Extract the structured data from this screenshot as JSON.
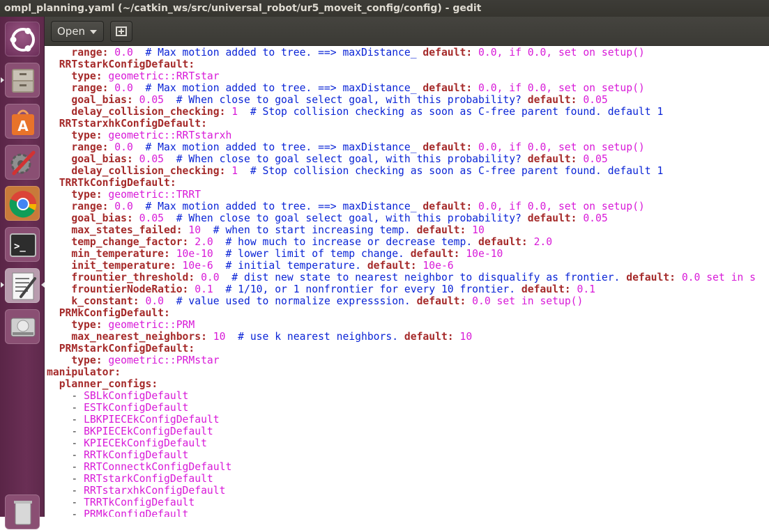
{
  "window": {
    "title": "ompl_planning.yaml (~/catkin_ws/src/universal_robot/ur5_moveit_config/config) - gedit"
  },
  "launcher": {
    "items": [
      {
        "name": "ubuntu-dash-icon"
      },
      {
        "name": "files-icon"
      },
      {
        "name": "software-center-icon"
      },
      {
        "name": "system-settings-icon"
      },
      {
        "name": "chrome-icon"
      },
      {
        "name": "terminal-icon"
      },
      {
        "name": "text-editor-icon"
      },
      {
        "name": "drive-icon"
      },
      {
        "name": "trash-icon"
      }
    ]
  },
  "toolbar": {
    "open_label": "Open",
    "new_tab_icon": "new-tab-icon"
  },
  "colors": {
    "key": "#a52a2a",
    "string": "#d81ad8",
    "comment": "#0a24d6",
    "launcher": "#6a2f55",
    "titlebar": "#3c3b37"
  },
  "editor": {
    "lines": [
      [
        {
          "t": "p",
          "v": "    "
        },
        {
          "t": "k",
          "v": "range:"
        },
        {
          "t": "s",
          "v": " 0.0"
        },
        {
          "t": "c",
          "v": "  # Max motion added to tree. ==> maxDistance_ "
        },
        {
          "t": "k",
          "v": "default:"
        },
        {
          "t": "s",
          "v": " 0.0, if 0.0, set on setup()"
        }
      ],
      [
        {
          "t": "p",
          "v": "  "
        },
        {
          "t": "k",
          "v": "RRTstarkConfigDefault:"
        }
      ],
      [
        {
          "t": "p",
          "v": "    "
        },
        {
          "t": "k",
          "v": "type:"
        },
        {
          "t": "s",
          "v": " geometric::RRTstar"
        }
      ],
      [
        {
          "t": "p",
          "v": "    "
        },
        {
          "t": "k",
          "v": "range:"
        },
        {
          "t": "s",
          "v": " 0.0"
        },
        {
          "t": "c",
          "v": "  # Max motion added to tree. ==> maxDistance_ "
        },
        {
          "t": "k",
          "v": "default:"
        },
        {
          "t": "s",
          "v": " 0.0, if 0.0, set on setup()"
        }
      ],
      [
        {
          "t": "p",
          "v": "    "
        },
        {
          "t": "k",
          "v": "goal_bias:"
        },
        {
          "t": "s",
          "v": " 0.05"
        },
        {
          "t": "c",
          "v": "  # When close to goal select goal, with this probability? "
        },
        {
          "t": "k",
          "v": "default:"
        },
        {
          "t": "s",
          "v": " 0.05"
        }
      ],
      [
        {
          "t": "p",
          "v": "    "
        },
        {
          "t": "k",
          "v": "delay_collision_checking:"
        },
        {
          "t": "s",
          "v": " 1"
        },
        {
          "t": "c",
          "v": "  # Stop collision checking as soon as C-free parent found. default 1"
        }
      ],
      [
        {
          "t": "p",
          "v": "  "
        },
        {
          "t": "k",
          "v": "RRTstarxhkConfigDefault:"
        }
      ],
      [
        {
          "t": "p",
          "v": "    "
        },
        {
          "t": "k",
          "v": "type:"
        },
        {
          "t": "s",
          "v": " geometric::RRTstarxh"
        }
      ],
      [
        {
          "t": "p",
          "v": "    "
        },
        {
          "t": "k",
          "v": "range:"
        },
        {
          "t": "s",
          "v": " 0.0"
        },
        {
          "t": "c",
          "v": "  # Max motion added to tree. ==> maxDistance_ "
        },
        {
          "t": "k",
          "v": "default:"
        },
        {
          "t": "s",
          "v": " 0.0, if 0.0, set on setup()"
        }
      ],
      [
        {
          "t": "p",
          "v": "    "
        },
        {
          "t": "k",
          "v": "goal_bias:"
        },
        {
          "t": "s",
          "v": " 0.05"
        },
        {
          "t": "c",
          "v": "  # When close to goal select goal, with this probability? "
        },
        {
          "t": "k",
          "v": "default:"
        },
        {
          "t": "s",
          "v": " 0.05"
        }
      ],
      [
        {
          "t": "p",
          "v": "    "
        },
        {
          "t": "k",
          "v": "delay_collision_checking:"
        },
        {
          "t": "s",
          "v": " 1"
        },
        {
          "t": "c",
          "v": "  # Stop collision checking as soon as C-free parent found. default 1"
        }
      ],
      [
        {
          "t": "p",
          "v": "  "
        },
        {
          "t": "k",
          "v": "TRRTkConfigDefault:"
        }
      ],
      [
        {
          "t": "p",
          "v": "    "
        },
        {
          "t": "k",
          "v": "type:"
        },
        {
          "t": "s",
          "v": " geometric::TRRT"
        }
      ],
      [
        {
          "t": "p",
          "v": "    "
        },
        {
          "t": "k",
          "v": "range:"
        },
        {
          "t": "s",
          "v": " 0.0"
        },
        {
          "t": "c",
          "v": "  # Max motion added to tree. ==> maxDistance_ "
        },
        {
          "t": "k",
          "v": "default:"
        },
        {
          "t": "s",
          "v": " 0.0, if 0.0, set on setup()"
        }
      ],
      [
        {
          "t": "p",
          "v": "    "
        },
        {
          "t": "k",
          "v": "goal_bias:"
        },
        {
          "t": "s",
          "v": " 0.05"
        },
        {
          "t": "c",
          "v": "  # When close to goal select goal, with this probability? "
        },
        {
          "t": "k",
          "v": "default:"
        },
        {
          "t": "s",
          "v": " 0.05"
        }
      ],
      [
        {
          "t": "p",
          "v": "    "
        },
        {
          "t": "k",
          "v": "max_states_failed:"
        },
        {
          "t": "s",
          "v": " 10"
        },
        {
          "t": "c",
          "v": "  # when to start increasing temp. "
        },
        {
          "t": "k",
          "v": "default:"
        },
        {
          "t": "s",
          "v": " 10"
        }
      ],
      [
        {
          "t": "p",
          "v": "    "
        },
        {
          "t": "k",
          "v": "temp_change_factor:"
        },
        {
          "t": "s",
          "v": " 2.0"
        },
        {
          "t": "c",
          "v": "  # how much to increase or decrease temp. "
        },
        {
          "t": "k",
          "v": "default:"
        },
        {
          "t": "s",
          "v": " 2.0"
        }
      ],
      [
        {
          "t": "p",
          "v": "    "
        },
        {
          "t": "k",
          "v": "min_temperature:"
        },
        {
          "t": "s",
          "v": " 10e-10"
        },
        {
          "t": "c",
          "v": "  # lower limit of temp change. "
        },
        {
          "t": "k",
          "v": "default:"
        },
        {
          "t": "s",
          "v": " 10e-10"
        }
      ],
      [
        {
          "t": "p",
          "v": "    "
        },
        {
          "t": "k",
          "v": "init_temperature:"
        },
        {
          "t": "s",
          "v": " 10e-6"
        },
        {
          "t": "c",
          "v": "  # initial temperature. "
        },
        {
          "t": "k",
          "v": "default:"
        },
        {
          "t": "s",
          "v": " 10e-6"
        }
      ],
      [
        {
          "t": "p",
          "v": "    "
        },
        {
          "t": "k",
          "v": "frountier_threshold:"
        },
        {
          "t": "s",
          "v": " 0.0"
        },
        {
          "t": "c",
          "v": "  # dist new state to nearest neighbor to disqualify as frontier. "
        },
        {
          "t": "k",
          "v": "default:"
        },
        {
          "t": "s",
          "v": " 0.0 set in s"
        }
      ],
      [
        {
          "t": "p",
          "v": "    "
        },
        {
          "t": "k",
          "v": "frountierNodeRatio:"
        },
        {
          "t": "s",
          "v": " 0.1"
        },
        {
          "t": "c",
          "v": "  # 1/10, or 1 nonfrontier for every 10 frontier. "
        },
        {
          "t": "k",
          "v": "default:"
        },
        {
          "t": "s",
          "v": " 0.1"
        }
      ],
      [
        {
          "t": "p",
          "v": "    "
        },
        {
          "t": "k",
          "v": "k_constant:"
        },
        {
          "t": "s",
          "v": " 0.0"
        },
        {
          "t": "c",
          "v": "  # value used to normalize expresssion. "
        },
        {
          "t": "k",
          "v": "default:"
        },
        {
          "t": "s",
          "v": " 0.0 set in setup()"
        }
      ],
      [
        {
          "t": "p",
          "v": "  "
        },
        {
          "t": "k",
          "v": "PRMkConfigDefault:"
        }
      ],
      [
        {
          "t": "p",
          "v": "    "
        },
        {
          "t": "k",
          "v": "type:"
        },
        {
          "t": "s",
          "v": " geometric::PRM"
        }
      ],
      [
        {
          "t": "p",
          "v": "    "
        },
        {
          "t": "k",
          "v": "max_nearest_neighbors:"
        },
        {
          "t": "s",
          "v": " 10"
        },
        {
          "t": "c",
          "v": "  # use k nearest neighbors. "
        },
        {
          "t": "k",
          "v": "default:"
        },
        {
          "t": "s",
          "v": " 10"
        }
      ],
      [
        {
          "t": "p",
          "v": "  "
        },
        {
          "t": "k",
          "v": "PRMstarkConfigDefault:"
        }
      ],
      [
        {
          "t": "p",
          "v": "    "
        },
        {
          "t": "k",
          "v": "type:"
        },
        {
          "t": "s",
          "v": " geometric::PRMstar"
        }
      ],
      [
        {
          "t": "k",
          "v": "manipulator:"
        }
      ],
      [
        {
          "t": "p",
          "v": "  "
        },
        {
          "t": "k",
          "v": "planner_configs:"
        }
      ],
      [
        {
          "t": "p",
          "v": "    - "
        },
        {
          "t": "s",
          "v": "SBLkConfigDefault"
        }
      ],
      [
        {
          "t": "p",
          "v": "    - "
        },
        {
          "t": "s",
          "v": "ESTkConfigDefault"
        }
      ],
      [
        {
          "t": "p",
          "v": "    - "
        },
        {
          "t": "s",
          "v": "LBKPIECEkConfigDefault"
        }
      ],
      [
        {
          "t": "p",
          "v": "    - "
        },
        {
          "t": "s",
          "v": "BKPIECEkConfigDefault"
        }
      ],
      [
        {
          "t": "p",
          "v": "    - "
        },
        {
          "t": "s",
          "v": "KPIECEkConfigDefault"
        }
      ],
      [
        {
          "t": "p",
          "v": "    - "
        },
        {
          "t": "s",
          "v": "RRTkConfigDefault"
        }
      ],
      [
        {
          "t": "p",
          "v": "    - "
        },
        {
          "t": "s",
          "v": "RRTConnectkConfigDefault"
        }
      ],
      [
        {
          "t": "p",
          "v": "    - "
        },
        {
          "t": "s",
          "v": "RRTstarkConfigDefault"
        }
      ],
      [
        {
          "t": "p",
          "v": "    - "
        },
        {
          "t": "s",
          "v": "RRTstarxhkConfigDefault"
        }
      ],
      [
        {
          "t": "p",
          "v": "    - "
        },
        {
          "t": "s",
          "v": "TRRTkConfigDefault"
        }
      ],
      [
        {
          "t": "p",
          "v": "    - "
        },
        {
          "t": "s",
          "v": "PRMkConfigDefault"
        }
      ]
    ]
  }
}
